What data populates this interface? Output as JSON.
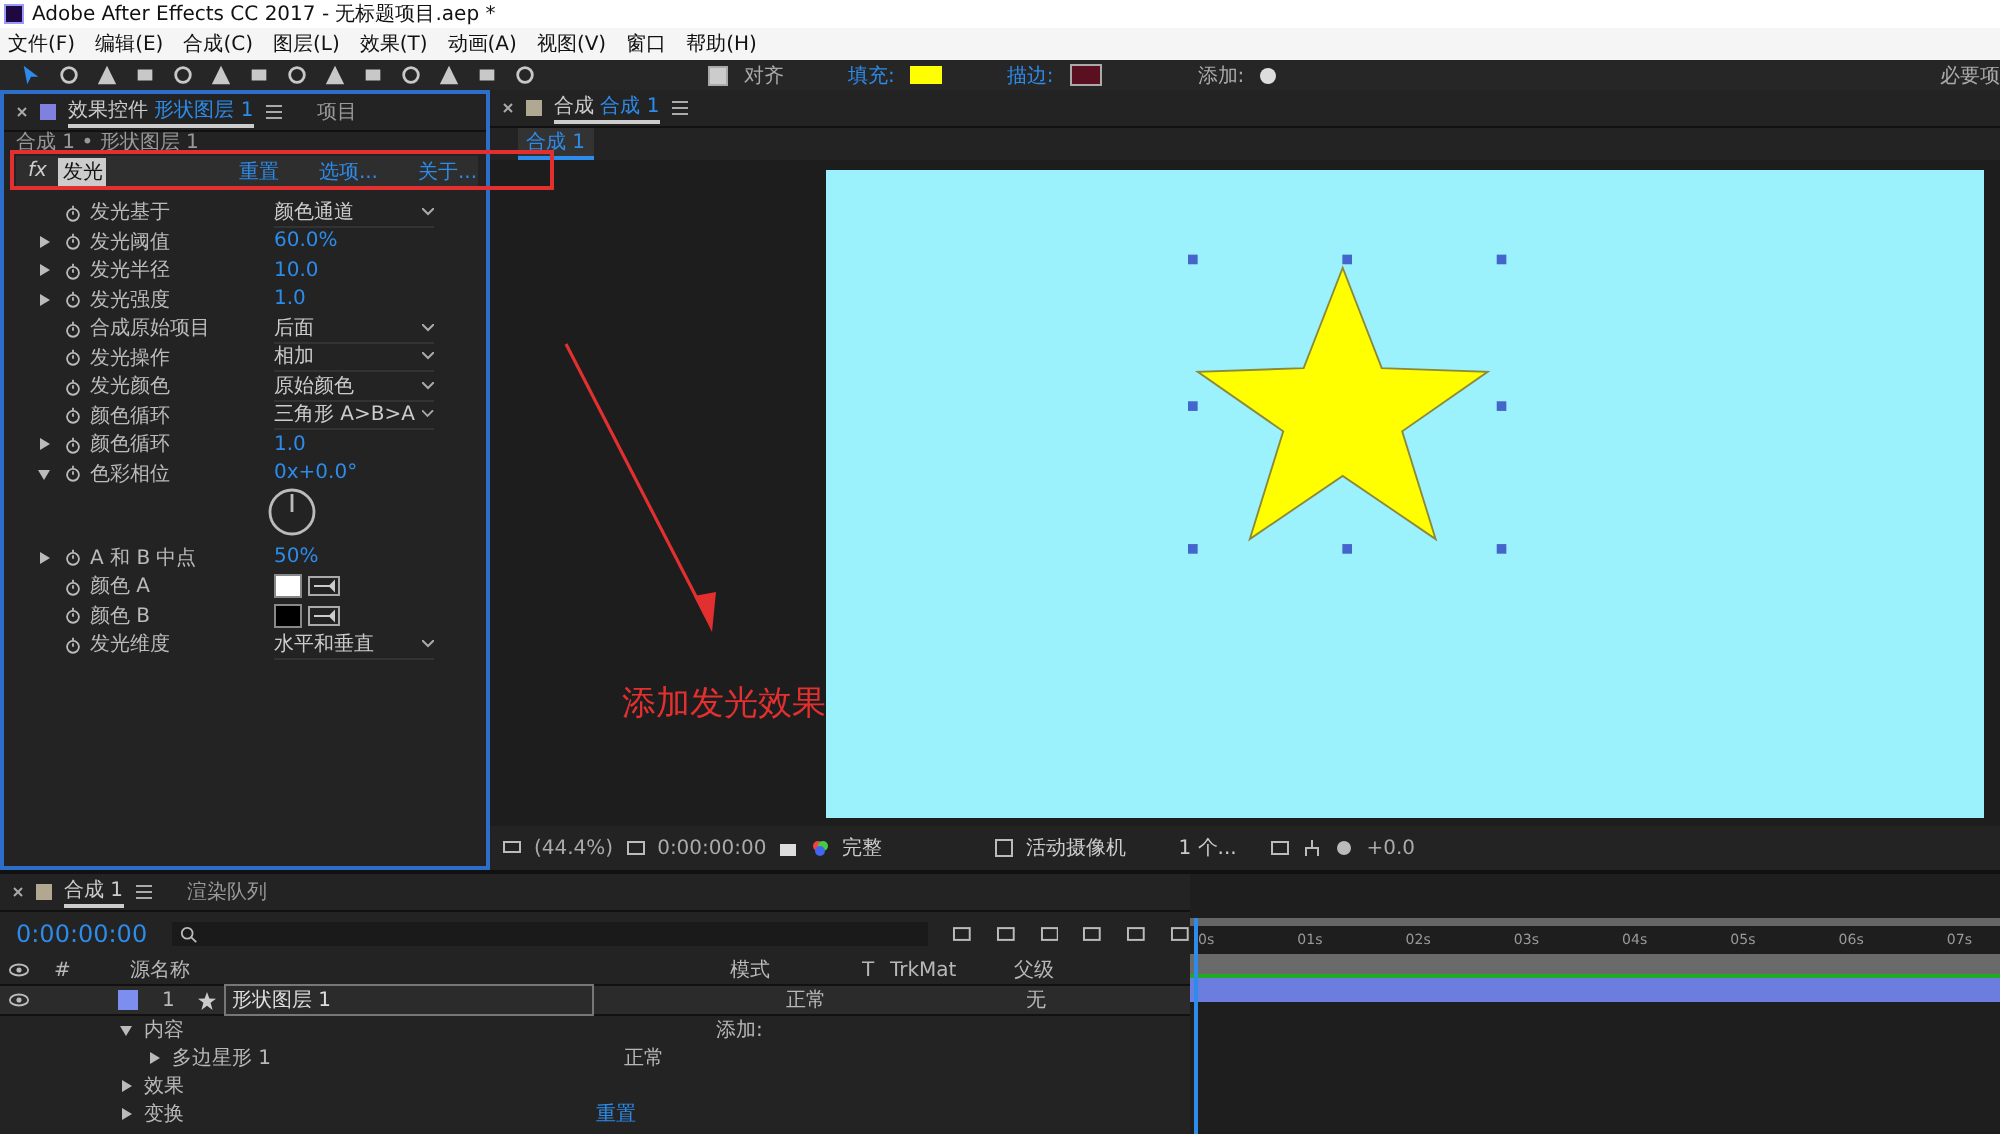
{
  "window": {
    "title": "Adobe After Effects CC 2017 - 无标题项目.aep *"
  },
  "menu": [
    "文件(F)",
    "编辑(E)",
    "合成(C)",
    "图层(L)",
    "效果(T)",
    "动画(A)",
    "视图(V)",
    "窗口",
    "帮助(H)"
  ],
  "toolbar": {
    "align": {
      "label": "对齐",
      "checked": true
    },
    "fill_label": "填充:",
    "stroke_label": "描边:",
    "add_label": "添加:",
    "workspace": "必要项"
  },
  "effect_panel": {
    "tabs": [
      {
        "label": "效果控件",
        "layer": "形状图层 1",
        "selected": true
      },
      {
        "label": "项目",
        "selected": false
      }
    ],
    "breadcrumb": "合成 1 • 形状图层 1",
    "effect": {
      "fx": "fx",
      "name": "发光",
      "links": [
        "重置",
        "选项...",
        "关于..."
      ]
    },
    "properties": [
      {
        "kind": "dropdown",
        "name": "发光基于",
        "value": "颜色通道"
      },
      {
        "kind": "value",
        "name": "发光阈值",
        "value": "60.0%",
        "expanded": false
      },
      {
        "kind": "value",
        "name": "发光半径",
        "value": "10.0",
        "expanded": false
      },
      {
        "kind": "value",
        "name": "发光强度",
        "value": "1.0",
        "expanded": false
      },
      {
        "kind": "dropdown",
        "name": "合成原始项目",
        "value": "后面"
      },
      {
        "kind": "dropdown",
        "name": "发光操作",
        "value": "相加"
      },
      {
        "kind": "dropdown",
        "name": "发光颜色",
        "value": "原始颜色"
      },
      {
        "kind": "dropdown",
        "name": "颜色循环",
        "value": "三角形 A>B>A"
      },
      {
        "kind": "value",
        "name": "颜色循环",
        "value": "1.0",
        "expanded": false
      },
      {
        "kind": "dial",
        "name": "色彩相位",
        "value": "0x+0.0°",
        "expanded": true
      },
      {
        "kind": "value",
        "name": "A 和 B 中点",
        "value": "50%",
        "expanded": false
      },
      {
        "kind": "color",
        "name": "颜色 A",
        "color": "#ffffff"
      },
      {
        "kind": "color",
        "name": "颜色 B",
        "color": "#000000"
      },
      {
        "kind": "dropdown",
        "name": "发光维度",
        "value": "水平和垂直"
      }
    ]
  },
  "viewer": {
    "tab": {
      "label": "合成",
      "comp": "合成 1"
    },
    "comp_chip": "合成 1",
    "annotation": "添加发光效果",
    "bar": {
      "zoom": "(44.4%)",
      "time": "0:00:00:00",
      "resolution": "完整",
      "camera": "活动摄像机",
      "views": "1 个...",
      "exposure": "+0.0"
    }
  },
  "timeline": {
    "tabs": [
      {
        "label": "合成 1",
        "selected": true
      },
      {
        "label": "渲染队列",
        "selected": false
      }
    ],
    "time": "0:00:00:00",
    "columns": {
      "number": "#",
      "source": "源名称",
      "mode": "模式",
      "t": "T",
      "trkmat": "TrkMat",
      "parent": "父级"
    },
    "layer": {
      "number": "1",
      "name": "形状图层 1",
      "mode": "正常",
      "parent": "无"
    },
    "children": [
      {
        "name": "内容",
        "expanded": true,
        "add": "添加:",
        "children": [
          {
            "name": "多边星形 1",
            "expanded": false,
            "mode": "正常"
          }
        ]
      },
      {
        "name": "效果",
        "expanded": false
      },
      {
        "name": "变换",
        "expanded": false,
        "reset": "重置"
      }
    ],
    "ruler": [
      "0s",
      "01s",
      "02s",
      "03s",
      "04s",
      "05s",
      "06s",
      "07s"
    ]
  }
}
